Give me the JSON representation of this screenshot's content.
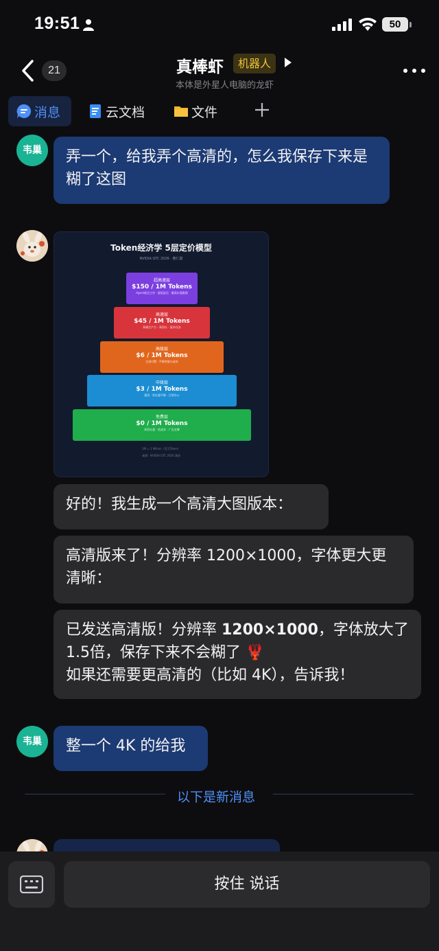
{
  "status_bar": {
    "time": "19:51",
    "battery": "50"
  },
  "header": {
    "unread_count": "21",
    "title": "真棒虾",
    "badge": "机器人",
    "subtitle": "本体是外星人电脑的龙虾"
  },
  "tabs": [
    {
      "label": "消息",
      "icon": "message-icon",
      "active": true
    },
    {
      "label": "云文档",
      "icon": "doc-icon",
      "active": false
    },
    {
      "label": "文件",
      "icon": "folder-icon",
      "active": false
    }
  ],
  "messages": {
    "user_avatar": "韦巢",
    "m1": "弄一个，给我弄个高清的，怎么我保存下来是糊了这图",
    "m2": "好的！我生成一个高清大图版本：",
    "m3": "高清版来了！分辨率 1200×1000，字体更大更清晰：",
    "m4_a": "已发送高清版！分辨率 ",
    "m4_bold": "1200×1000",
    "m4_b": "，字体放大了 1.5倍，保存下来不会糊了 🦞",
    "m4_c": "如果还需要更高清的（比如 4K），告诉我！",
    "m5": "整一个 4K 的给我"
  },
  "shared_image": {
    "title": "Token经济学 5层定价模型",
    "subtitle": "NVIDIA GTC 2026 · 黄仁勋",
    "tiers": [
      {
        "name": "超高速层",
        "price": "$150 / 1M Tokens",
        "desc": "Agent前沿工作 · 超低延迟 · 最高价值推理",
        "color": "#7b3fe0"
      },
      {
        "name": "高速层",
        "price": "$45 / 1M Tokens",
        "desc": "高端生产力 · 高吞吐 · 复杂任务",
        "color": "#d8343b"
      },
      {
        "name": "高级层",
        "price": "$6 / 1M Tokens",
        "desc": "主流付费 · 平衡性能与成本",
        "color": "#e1661d"
      },
      {
        "name": "中级层",
        "price": "$3 / 1M Tokens",
        "desc": "通用 · 吞吐量平衡 · 日常办公",
        "color": "#1c8dd2"
      },
      {
        "name": "免费层",
        "price": "$0 / 1M Tokens",
        "desc": "高吞吐量 · 低成本 · 广告支撑",
        "color": "#20ad4c"
      }
    ],
    "footer_1": "1M = 1 Million（百万Token）",
    "footer_2": "来源：NVIDIA GTC 2026 演讲"
  },
  "divider_text": "以下是新消息",
  "bottom": {
    "talk_label": "按住 说话"
  },
  "colors": {
    "accent": "#4f8ff7",
    "my_bubble": "#1c3a73",
    "bot_bubble": "#2a2a2d",
    "badge": "#f0c33c"
  }
}
